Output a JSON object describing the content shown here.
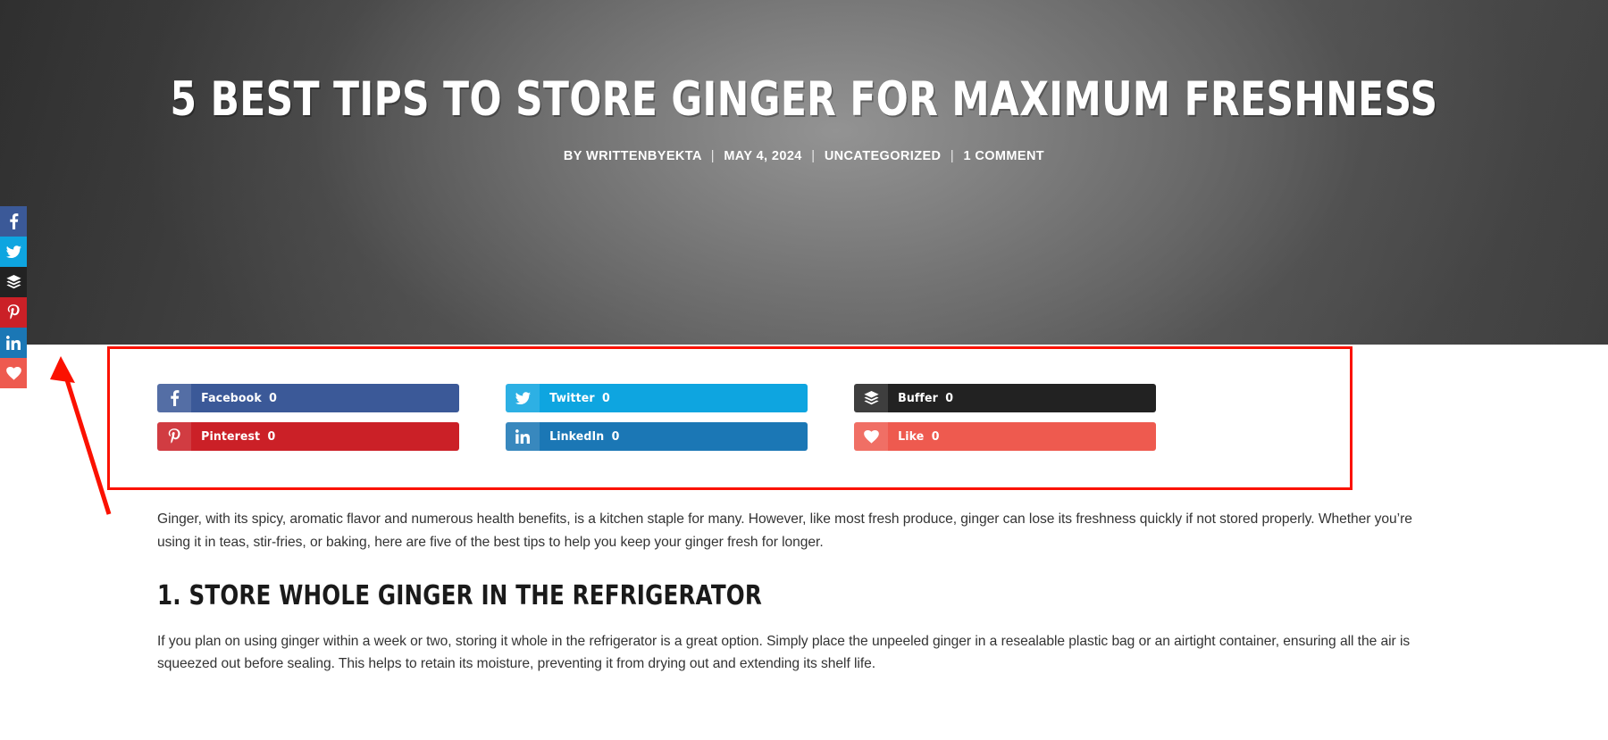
{
  "hero": {
    "title": "5 Best Tips to Store Ginger for Maximum Freshness",
    "meta": {
      "author": "BY WRITTENBYEKTA",
      "date": "MAY 4, 2024",
      "category": "UNCATEGORIZED",
      "comments": "1 COMMENT",
      "separator": "|"
    },
    "background_gradient_from": "#2f2f2f",
    "background_gradient_to": "#616161"
  },
  "side_share": {
    "items": [
      {
        "name": "Facebook",
        "icon": "facebook-icon",
        "color": "#3b5998"
      },
      {
        "name": "Twitter",
        "icon": "twitter-icon",
        "color": "#0ea5e0"
      },
      {
        "name": "Buffer",
        "icon": "buffer-icon",
        "color": "#222222"
      },
      {
        "name": "Pinterest",
        "icon": "pinterest-icon",
        "color": "#cb2027"
      },
      {
        "name": "LinkedIn",
        "icon": "linkedin-icon",
        "color": "#1b77b5"
      },
      {
        "name": "Like",
        "icon": "heart-icon",
        "color": "#ee5a4f"
      }
    ]
  },
  "share_buttons": [
    {
      "label": "Facebook",
      "count": "0",
      "icon": "facebook-icon",
      "color": "#3b5998"
    },
    {
      "label": "Twitter",
      "count": "0",
      "icon": "twitter-icon",
      "color": "#0ea5e0"
    },
    {
      "label": "Buffer",
      "count": "0",
      "icon": "buffer-icon",
      "color": "#222222"
    },
    {
      "label": "Pinterest",
      "count": "0",
      "icon": "pinterest-icon",
      "color": "#cb2027"
    },
    {
      "label": "LinkedIn",
      "count": "0",
      "icon": "linkedin-icon",
      "color": "#1b77b5"
    },
    {
      "label": "Like",
      "count": "0",
      "icon": "heart-icon",
      "color": "#ee5a4f"
    }
  ],
  "annotation": {
    "color": "#fb1100",
    "arrow_target": "Like sidebar button"
  },
  "article": {
    "intro": "Ginger, with its spicy, aromatic flavor and numerous health benefits, is a kitchen staple for many. However, like most fresh produce, ginger can lose its freshness quickly if not stored properly. Whether you’re using it in teas, stir-fries, or baking, here are five of the best tips to help you keep your ginger fresh for longer.",
    "section_heading": "1. Store Whole Ginger in the Refrigerator",
    "section_body": "If you plan on using ginger within a week or two, storing it whole in the refrigerator is a great option. Simply place the unpeeled ginger in a resealable plastic bag or an airtight container, ensuring all the air is squeezed out before sealing. This helps to retain its moisture, preventing it from drying out and extending its shelf life."
  }
}
